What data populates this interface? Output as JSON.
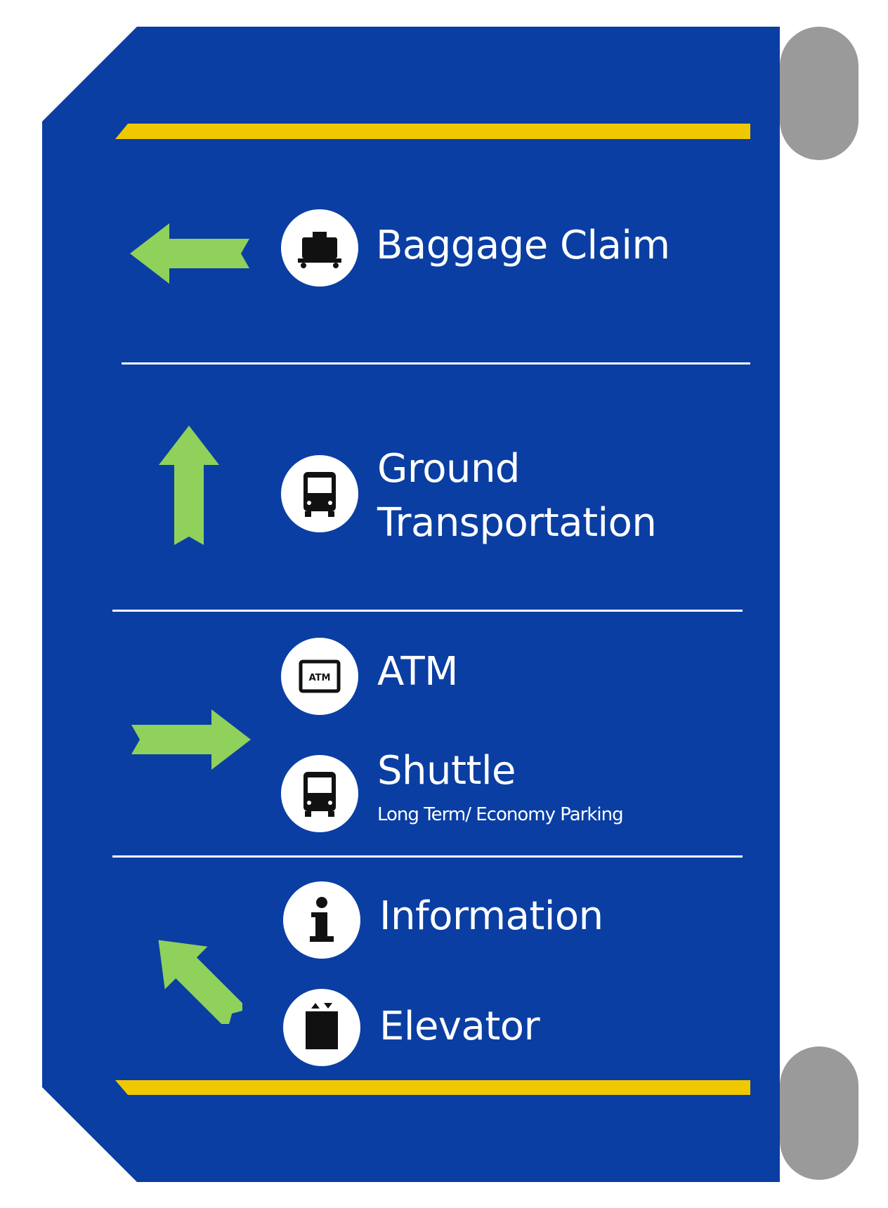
{
  "colors": {
    "panel": "#0a3ea3",
    "accent_bar": "#f0c800",
    "arrow": "#8fd15a",
    "bracket": "#9a9a9a",
    "divider": "#ffffff",
    "icon_bg": "#ffffff",
    "icon_fg": "#111111"
  },
  "sections": [
    {
      "arrow": "arrow-left",
      "entries": [
        {
          "icon": "baggage-claim-icon",
          "label": "Baggage Claim"
        }
      ]
    },
    {
      "arrow": "arrow-up",
      "entries": [
        {
          "icon": "bus-icon",
          "label_line1": "Ground",
          "label_line2": "Transportation"
        }
      ]
    },
    {
      "arrow": "arrow-right",
      "entries": [
        {
          "icon": "atm-icon",
          "label": "ATM",
          "icon_text": "ATM"
        },
        {
          "icon": "bus-icon",
          "label": "Shuttle",
          "sublabel": "Long Term/ Economy Parking"
        }
      ]
    },
    {
      "arrow": "arrow-up-left",
      "entries": [
        {
          "icon": "information-icon",
          "label": "Information"
        },
        {
          "icon": "elevator-icon",
          "label": "Elevator"
        }
      ]
    }
  ]
}
